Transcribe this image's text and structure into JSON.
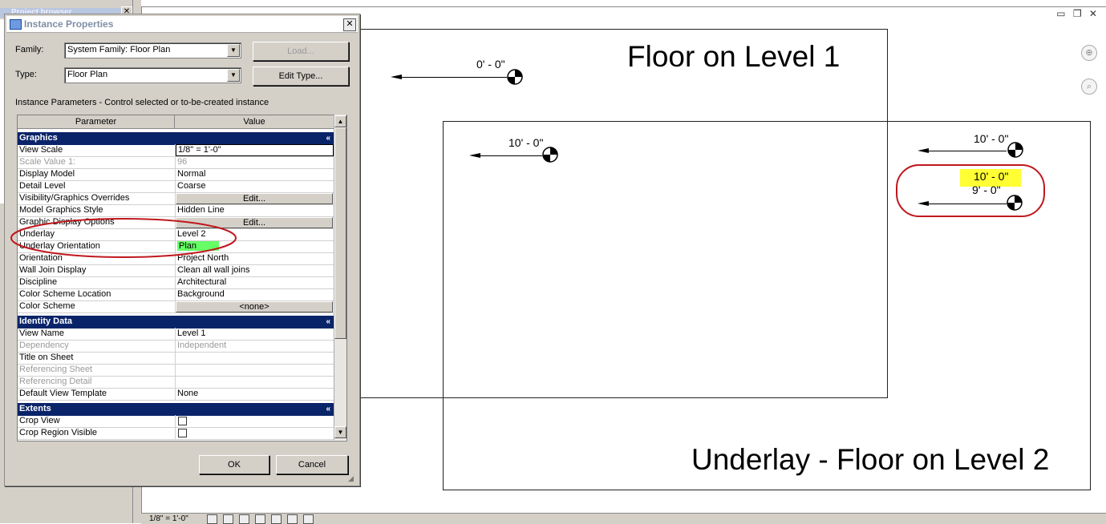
{
  "project_browser": {
    "title": "Project browser",
    "close_label": "✕"
  },
  "window_controls": "▭ ❐ ✕",
  "status_bar": {
    "scale": "1/8\" = 1'-0\""
  },
  "drawing": {
    "floor1_label": "Floor on Level 1",
    "underlay_label": "Underlay - Floor on Level 2",
    "elevations": {
      "e1": "0' - 0\"",
      "e2": "10' - 0\"",
      "e3": "10' - 0\"",
      "e4a": "10' - 0\"",
      "e4b": "9' - 0\""
    },
    "highlight_color": "#ffff33",
    "circle_color": "#c0181e"
  },
  "dialog": {
    "title": "Instance Properties",
    "close_label": "✕",
    "family_label": "Family:",
    "family_value": "System Family: Floor Plan",
    "type_label": "Type:",
    "type_value": "Floor Plan",
    "load_button": "Load...",
    "edit_type_button": "Edit Type...",
    "instance_caption": "Instance Parameters - Control selected or to-be-created instance",
    "col_parameter": "Parameter",
    "col_value": "Value",
    "groups": {
      "graphics": "Graphics",
      "identity": "Identity Data",
      "extents": "Extents"
    },
    "rows": {
      "view_scale": {
        "p": "View Scale",
        "v": "1/8\" = 1'-0\""
      },
      "scale_value": {
        "p": "Scale Value    1:",
        "v": "96"
      },
      "display_model": {
        "p": "Display Model",
        "v": "Normal"
      },
      "detail_level": {
        "p": "Detail Level",
        "v": "Coarse"
      },
      "vg_overrides": {
        "p": "Visibility/Graphics Overrides",
        "v": "Edit..."
      },
      "model_graphics": {
        "p": "Model Graphics Style",
        "v": "Hidden Line"
      },
      "graphic_display": {
        "p": "Graphic Display Options",
        "v": "Edit..."
      },
      "underlay": {
        "p": "Underlay",
        "v": "Level 2"
      },
      "underlay_orient": {
        "p": "Underlay Orientation",
        "v": "Plan"
      },
      "orientation": {
        "p": "Orientation",
        "v": "Project North"
      },
      "wall_join": {
        "p": "Wall Join Display",
        "v": "Clean all wall joins"
      },
      "discipline": {
        "p": "Discipline",
        "v": "Architectural"
      },
      "color_scheme_loc": {
        "p": "Color Scheme Location",
        "v": "Background"
      },
      "color_scheme": {
        "p": "Color Scheme",
        "v": "<none>"
      },
      "view_name": {
        "p": "View Name",
        "v": "Level 1"
      },
      "dependency": {
        "p": "Dependency",
        "v": "Independent"
      },
      "title_on_sheet": {
        "p": "Title on Sheet",
        "v": ""
      },
      "ref_sheet": {
        "p": "Referencing Sheet",
        "v": ""
      },
      "ref_detail": {
        "p": "Referencing Detail",
        "v": ""
      },
      "default_template": {
        "p": "Default View Template",
        "v": "None"
      },
      "crop_view": {
        "p": "Crop View",
        "v": ""
      },
      "crop_region": {
        "p": "Crop Region Visible",
        "v": ""
      }
    },
    "collapse_glyph": "«",
    "ok_button": "OK",
    "cancel_button": "Cancel",
    "highlight_green": "#66ff66"
  }
}
